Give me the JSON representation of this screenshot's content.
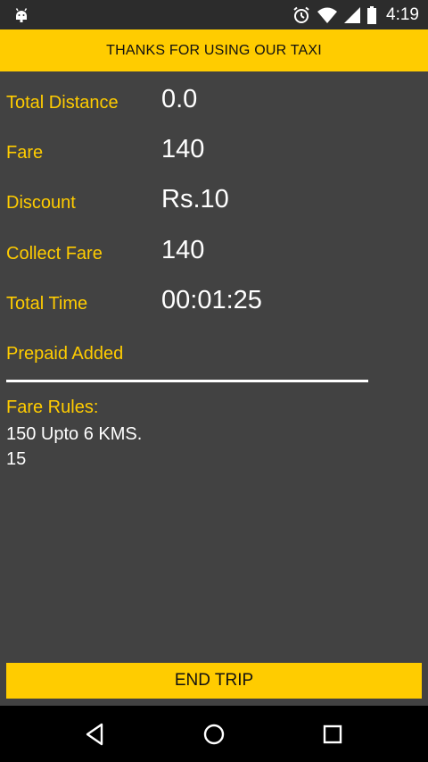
{
  "status_bar": {
    "time": "4:19",
    "icons": [
      "android-debug-icon",
      "alarm-icon",
      "wifi-icon",
      "signal-icon",
      "battery-icon"
    ]
  },
  "header": {
    "title": "THANKS FOR USING OUR TAXI"
  },
  "summary": {
    "total_distance": {
      "label": "Total Distance",
      "value": "0.0"
    },
    "fare": {
      "label": "Fare",
      "value": "140"
    },
    "discount": {
      "label": "Discount",
      "value": "Rs.10"
    },
    "collect_fare": {
      "label": "Collect Fare",
      "value": "140"
    },
    "total_time": {
      "label": "Total Time",
      "value": "00:01:25"
    },
    "prepaid": {
      "label": "Prepaid Added",
      "value": ""
    }
  },
  "fare_rules": {
    "heading": "Fare Rules:",
    "lines": [
      "150 Upto 6 KMS.",
      "15"
    ]
  },
  "actions": {
    "end_trip": "END TRIP"
  },
  "colors": {
    "accent": "#ffcc00",
    "background": "#424242",
    "text": "#ffffff"
  },
  "nav_bar": {
    "icons": [
      "back-icon",
      "home-icon",
      "recents-icon"
    ]
  }
}
